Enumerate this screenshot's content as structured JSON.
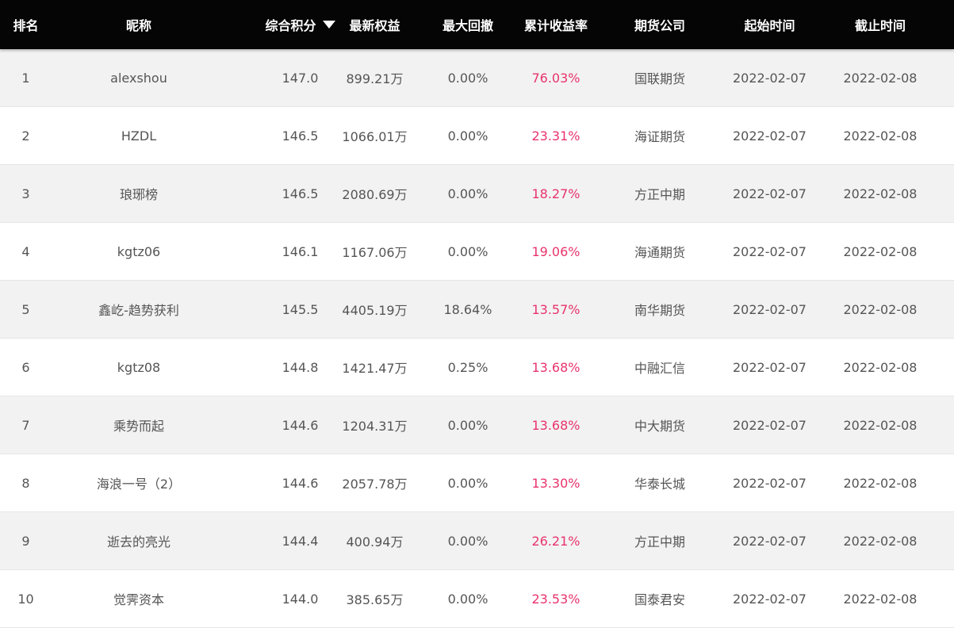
{
  "header": {
    "rank": "排名",
    "name": "昵称",
    "score": "综合积分",
    "equity": "最新权益",
    "drawdown": "最大回撤",
    "return": "累计收益率",
    "company": "期货公司",
    "start": "起始时间",
    "end": "截止时间"
  },
  "colors": {
    "header_bg": "#050505",
    "return_color": "#e8336d",
    "odd_row": "#f2f2f2",
    "even_row": "#ffffff"
  },
  "rows": [
    {
      "rank": "1",
      "name": "alexshou",
      "score": "147.0",
      "equity": "899.21万",
      "drawdown": "0.00%",
      "return": "76.03%",
      "company": "国联期货",
      "start": "2022-02-07",
      "end": "2022-02-08"
    },
    {
      "rank": "2",
      "name": "HZDL",
      "score": "146.5",
      "equity": "1066.01万",
      "drawdown": "0.00%",
      "return": "23.31%",
      "company": "海证期货",
      "start": "2022-02-07",
      "end": "2022-02-08"
    },
    {
      "rank": "3",
      "name": "琅琊榜",
      "score": "146.5",
      "equity": "2080.69万",
      "drawdown": "0.00%",
      "return": "18.27%",
      "company": "方正中期",
      "start": "2022-02-07",
      "end": "2022-02-08"
    },
    {
      "rank": "4",
      "name": "kgtz06",
      "score": "146.1",
      "equity": "1167.06万",
      "drawdown": "0.00%",
      "return": "19.06%",
      "company": "海通期货",
      "start": "2022-02-07",
      "end": "2022-02-08"
    },
    {
      "rank": "5",
      "name": "鑫屹-趋势获利",
      "score": "145.5",
      "equity": "4405.19万",
      "drawdown": "18.64%",
      "return": "13.57%",
      "company": "南华期货",
      "start": "2022-02-07",
      "end": "2022-02-08"
    },
    {
      "rank": "6",
      "name": "kgtz08",
      "score": "144.8",
      "equity": "1421.47万",
      "drawdown": "0.25%",
      "return": "13.68%",
      "company": "中融汇信",
      "start": "2022-02-07",
      "end": "2022-02-08"
    },
    {
      "rank": "7",
      "name": "乘势而起",
      "score": "144.6",
      "equity": "1204.31万",
      "drawdown": "0.00%",
      "return": "13.68%",
      "company": "中大期货",
      "start": "2022-02-07",
      "end": "2022-02-08"
    },
    {
      "rank": "8",
      "name": "海浪一号（2）",
      "score": "144.6",
      "equity": "2057.78万",
      "drawdown": "0.00%",
      "return": "13.30%",
      "company": "华泰长城",
      "start": "2022-02-07",
      "end": "2022-02-08"
    },
    {
      "rank": "9",
      "name": "逝去的亮光",
      "score": "144.4",
      "equity": "400.94万",
      "drawdown": "0.00%",
      "return": "26.21%",
      "company": "方正中期",
      "start": "2022-02-07",
      "end": "2022-02-08"
    },
    {
      "rank": "10",
      "name": "觉霁资本",
      "score": "144.0",
      "equity": "385.65万",
      "drawdown": "0.00%",
      "return": "23.53%",
      "company": "国泰君安",
      "start": "2022-02-07",
      "end": "2022-02-08"
    }
  ]
}
